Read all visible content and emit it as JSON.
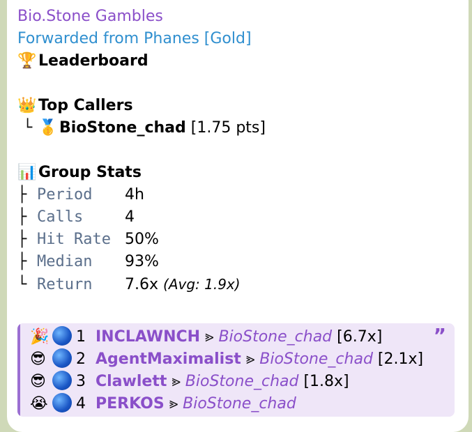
{
  "sender": "Bio.Stone Gambles",
  "forwarded_from": "Forwarded from Phanes [Gold]",
  "leaderboard": {
    "icon": "🏆",
    "title": "Leaderboard"
  },
  "top_callers": {
    "icon": "👑",
    "title": "Top Callers",
    "entries": [
      {
        "tree": "└",
        "medal": "🥇",
        "name": "BioStone_chad",
        "pts": "[1.75 pts]"
      }
    ]
  },
  "group_stats": {
    "icon": "📊",
    "title": "Group Stats",
    "rows": [
      {
        "tree": "├",
        "label": "Period",
        "value": "4h",
        "extra": ""
      },
      {
        "tree": "├",
        "label": "Calls",
        "value": "4",
        "extra": ""
      },
      {
        "tree": "├",
        "label": "Hit Rate",
        "value": "50%",
        "extra": ""
      },
      {
        "tree": "├",
        "label": "Median",
        "value": "93%",
        "extra": ""
      },
      {
        "tree": "└",
        "label": "Return",
        "value": "7.6x",
        "extra": "(Avg: 1.9x)"
      }
    ]
  },
  "quote": {
    "mark": "”",
    "rows": [
      {
        "emoji": "🎉",
        "rank": "1",
        "token": "INCLAWNCH",
        "arrow": "⪢",
        "user": "BioStone_chad",
        "mult": "[6.7x]"
      },
      {
        "emoji": "😎",
        "rank": "2",
        "token": "AgentMaximalist",
        "arrow": "⪢",
        "user": "BioStone_chad",
        "mult": "[2.1x]"
      },
      {
        "emoji": "😎",
        "rank": "3",
        "token": "Clawlett",
        "arrow": "⪢",
        "user": "BioStone_chad",
        "mult": "[1.8x]"
      },
      {
        "emoji": "😭",
        "rank": "4",
        "token": "PERKOS",
        "arrow": "⪢",
        "user": "BioStone_chad",
        "mult": ""
      }
    ]
  }
}
